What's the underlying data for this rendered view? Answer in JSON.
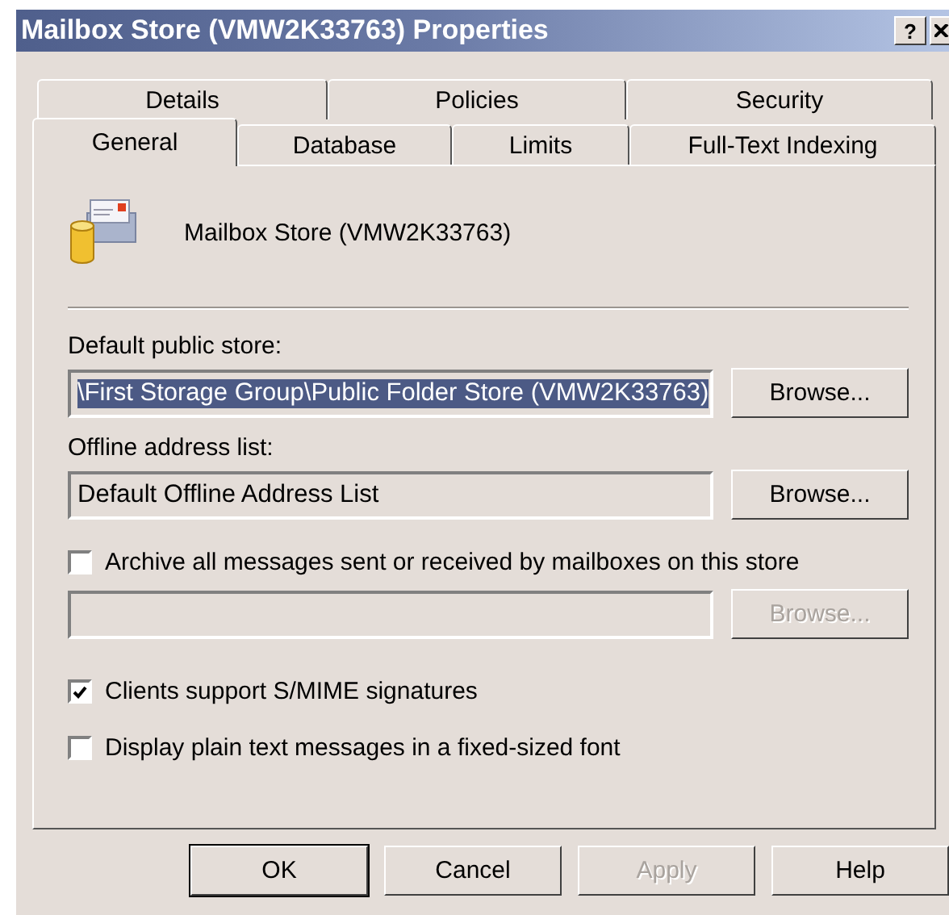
{
  "window": {
    "title": "Mailbox Store (VMW2K33763) Properties",
    "help_button": "?"
  },
  "tab_rows": [
    [
      {
        "label": "Details",
        "selected": false
      },
      {
        "label": "Policies",
        "selected": false
      },
      {
        "label": "Security",
        "selected": false
      }
    ],
    [
      {
        "label": "General",
        "selected": true
      },
      {
        "label": "Database",
        "selected": false
      },
      {
        "label": "Limits",
        "selected": false
      },
      {
        "label": "Full-Text Indexing",
        "selected": false
      }
    ]
  ],
  "store": {
    "name": "Mailbox Store (VMW2K33763)"
  },
  "options": [
    {
      "kind": "field",
      "label": "Default public store:",
      "value": "\\First Storage Group\\Public Folder Store (VMW2K33763)",
      "selected": true,
      "button": {
        "label": "Browse...",
        "disabled": false
      }
    },
    {
      "kind": "field",
      "label": "Offline address list:",
      "value": "Default Offline Address List",
      "selected": false,
      "button": {
        "label": "Browse...",
        "disabled": false
      }
    },
    {
      "kind": "checkbox",
      "label": "Archive all messages sent or received by mailboxes on this store",
      "checked": false
    },
    {
      "kind": "field",
      "button": {
        "label": "Browse...",
        "disabled": true
      }
    },
    {
      "kind": "checkbox",
      "label": "Clients support S/MIME signatures",
      "checked": true
    },
    {
      "kind": "checkbox",
      "label": "Display plain text messages in a fixed-sized font",
      "checked": false
    }
  ],
  "buttons": [
    {
      "label": "OK",
      "default": true,
      "disabled": false
    },
    {
      "label": "Cancel",
      "default": false,
      "disabled": false
    },
    {
      "label": "Apply",
      "default": false,
      "disabled": true
    },
    {
      "label": "Help",
      "default": false,
      "disabled": false
    }
  ]
}
